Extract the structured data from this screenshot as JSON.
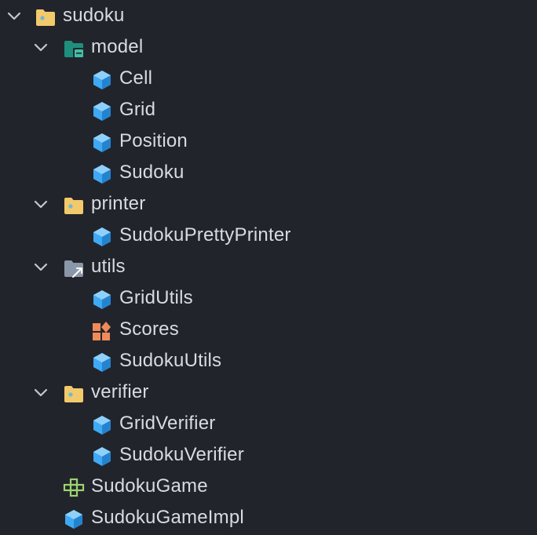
{
  "tree": {
    "root": {
      "label": "sudoku",
      "expanded": true,
      "icon": "folder-icon"
    },
    "model": {
      "label": "model",
      "expanded": true,
      "icon": "package-folder-icon",
      "children": [
        {
          "label": "Cell",
          "icon": "class-icon"
        },
        {
          "label": "Grid",
          "icon": "class-icon"
        },
        {
          "label": "Position",
          "icon": "class-icon"
        },
        {
          "label": "Sudoku",
          "icon": "class-icon"
        }
      ]
    },
    "printer": {
      "label": "printer",
      "expanded": true,
      "icon": "folder-icon",
      "children": [
        {
          "label": "SudokuPrettyPrinter",
          "icon": "class-icon"
        }
      ]
    },
    "utils": {
      "label": "utils",
      "expanded": true,
      "icon": "linked-folder-icon",
      "children": [
        {
          "label": "GridUtils",
          "icon": "class-icon"
        },
        {
          "label": "Scores",
          "icon": "enum-icon"
        },
        {
          "label": "SudokuUtils",
          "icon": "class-icon"
        }
      ]
    },
    "verifier": {
      "label": "verifier",
      "expanded": true,
      "icon": "folder-icon",
      "children": [
        {
          "label": "GridVerifier",
          "icon": "class-icon"
        },
        {
          "label": "SudokuVerifier",
          "icon": "class-icon"
        }
      ]
    },
    "files": [
      {
        "label": "SudokuGame",
        "icon": "module-icon"
      },
      {
        "label": "SudokuGameImpl",
        "icon": "class-icon"
      }
    ]
  },
  "colors": {
    "background": "#22242b",
    "text": "#d7dbe4",
    "chevron": "#c3c7d0",
    "folder": "#f2c96b",
    "folder_badge": "#6fb7d6",
    "package_folder": "#1f8f7d",
    "linked_folder": "#8a97a8",
    "class": "#3fa9f5",
    "enum": "#ef8a5a",
    "module": "#9dd36f"
  }
}
